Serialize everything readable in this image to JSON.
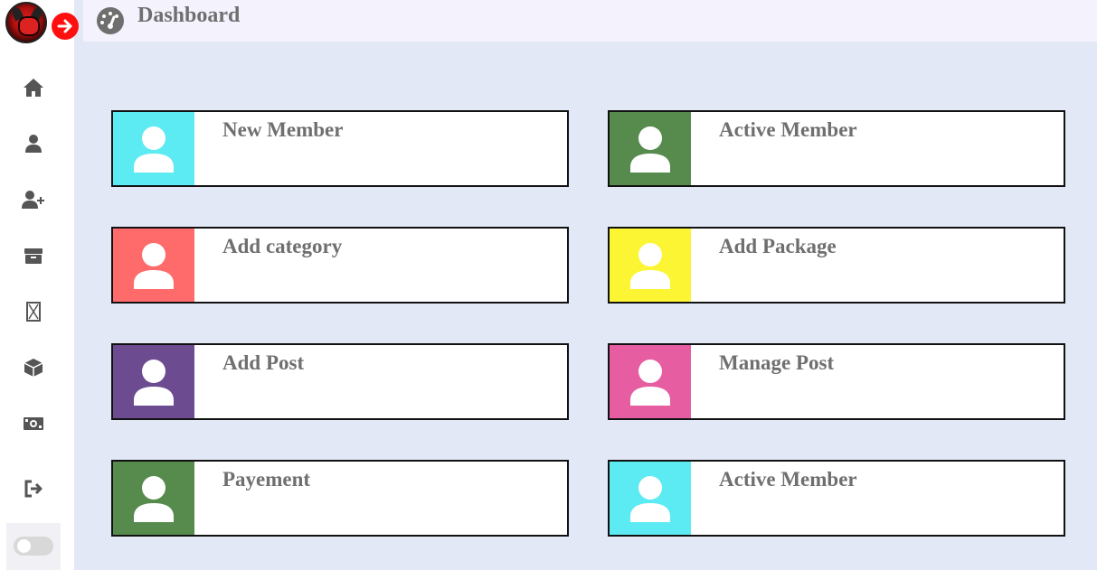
{
  "header": {
    "title": "Dashboard",
    "icon": "gauge-icon"
  },
  "sidebar": {
    "logo": "logo",
    "collapse_icon": "arrow-right-icon",
    "items": [
      {
        "icon": "home-icon"
      },
      {
        "icon": "user-icon"
      },
      {
        "icon": "user-plus-icon"
      },
      {
        "icon": "box-icon"
      },
      {
        "icon": "hourglass-icon"
      },
      {
        "icon": "cube-icon"
      },
      {
        "icon": "money-icon"
      },
      {
        "icon": "logout-icon"
      }
    ],
    "theme_toggle": {
      "on": false
    }
  },
  "cards": [
    {
      "label": "New Member",
      "color": "#5ceaf3",
      "icon": "user-icon"
    },
    {
      "label": "Active Member",
      "color": "#568b4d",
      "icon": "user-icon"
    },
    {
      "label": "Add category",
      "color": "#ff6b6b",
      "icon": "user-icon"
    },
    {
      "label": "Add Package",
      "color": "#fcf533",
      "icon": "user-icon"
    },
    {
      "label": "Add Post",
      "color": "#6c4b90",
      "icon": "user-icon"
    },
    {
      "label": "Manage Post",
      "color": "#e65da1",
      "icon": "user-icon"
    },
    {
      "label": "Payement",
      "color": "#568b4d",
      "icon": "user-icon"
    },
    {
      "label": "Active Member",
      "color": "#5ceaf3",
      "icon": "user-icon"
    }
  ]
}
